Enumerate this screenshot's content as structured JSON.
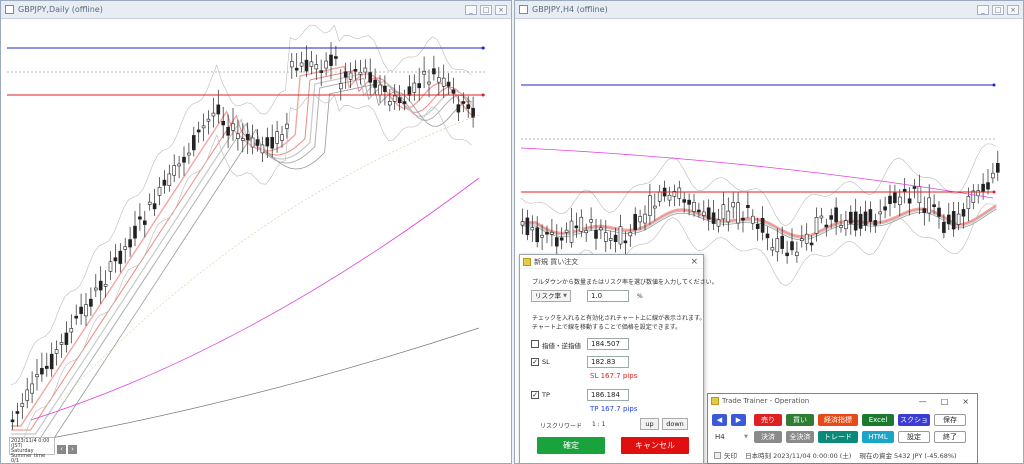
{
  "left_chart": {
    "title": "GBPJPY,Daily (offline)",
    "info": [
      "2023/11/4 0:00 (JST)",
      "Saturday",
      "Summer time    0/1"
    ]
  },
  "right_chart": {
    "title": "GBPJPY,H4 (offline)"
  },
  "window_buttons": [
    "_",
    "□",
    "×"
  ],
  "order_dialog": {
    "title": "新規 買い注文",
    "close": "×",
    "instruction": "プルダウンから数量またはリスク率を選び数値を入力してください。",
    "dropdown_label": "リスク率",
    "dropdown_arrow": "▼",
    "risk_value": "1.0",
    "percent_unit": "%",
    "note_line1": "チェックを入れると有効化されチャート上に線が表示されます。",
    "note_line2": "チャート上で線を移動することで価格を設定できます。",
    "limit_label": "指値・逆指値",
    "limit_value": "184.507",
    "limit_checked": false,
    "sl_label": "SL",
    "sl_value": "182.83",
    "sl_checked": true,
    "sl_pips": "SL 167.7 pips",
    "tp_label": "TP",
    "tp_value": "186.184",
    "tp_checked": true,
    "tp_pips": "TP 167.7 pips",
    "rr_label": "リスクリワード",
    "rr_value": "1 : 1",
    "up_label": "up",
    "down_label": "down",
    "confirm_label": "確定",
    "cancel_label": "キャンセル",
    "check_mark": "✓"
  },
  "trainer": {
    "title": "Trade Trainer - Operation",
    "controls": [
      "—",
      "□",
      "×"
    ],
    "prev": "◀",
    "next": "▶",
    "sell": "売り",
    "buy": "買い",
    "indicators": "経済指標",
    "excel": "Excel",
    "screenshot": "スクショ",
    "save": "保存",
    "timeframe": "H4",
    "timeframe_arrow": "▼",
    "settle": "決済",
    "settle_all": "全決済",
    "trend": "トレード",
    "html": "HTML",
    "settings": "設定",
    "exit": "終了",
    "arrow_label": "矢印",
    "jst_time": "日本時刻 2023/11/04 0:00:00 (土)",
    "balance": "現在の資金 5432 JPY (-45.68%)"
  },
  "colors": {
    "sell": "#e02020",
    "buy": "#2e7d32",
    "indicators": "#e64a19",
    "excel": "#1b7a2e",
    "screenshot": "#3b3bd6",
    "settle": "#8a8a8a",
    "trend": "#0b8a7a",
    "html": "#1ba5c8",
    "confirm": "#1aa33c",
    "cancel": "#e01010",
    "tp_line": "#2222cc",
    "sl_line": "#dd2222",
    "sl_pips": "#e02020",
    "tp_pips": "#2244ee"
  }
}
